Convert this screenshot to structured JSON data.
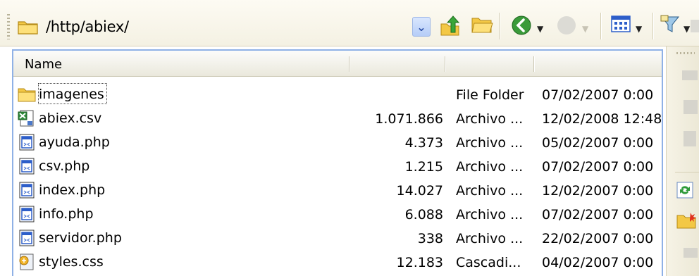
{
  "toolbar": {
    "path": "/http/abiex/",
    "icons": [
      "folder-icon",
      "dropdown-arrow-icon",
      "up-folder-icon",
      "open-folder-icon",
      "back-icon",
      "forward-icon",
      "view-icon",
      "filter-icon",
      "disconnect-icon"
    ]
  },
  "list": {
    "columns": [
      "Name",
      "",
      "",
      ""
    ],
    "rows": [
      {
        "icon": "folder-icon",
        "name": "imagenes",
        "size": "",
        "type": "File Folder",
        "date": "07/02/2007 0:00"
      },
      {
        "icon": "csv-file-icon",
        "name": "abiex.csv",
        "size": "1.071.866",
        "type": "Archivo ...",
        "date": "12/02/2008 12:48"
      },
      {
        "icon": "php-file-icon",
        "name": "ayuda.php",
        "size": "4.373",
        "type": "Archivo ...",
        "date": "05/02/2007 0:00"
      },
      {
        "icon": "php-file-icon",
        "name": "csv.php",
        "size": "1.215",
        "type": "Archivo ...",
        "date": "07/02/2007 0:00"
      },
      {
        "icon": "php-file-icon",
        "name": "index.php",
        "size": "14.027",
        "type": "Archivo ...",
        "date": "12/02/2007 0:00"
      },
      {
        "icon": "php-file-icon",
        "name": "info.php",
        "size": "6.088",
        "type": "Archivo ...",
        "date": "07/02/2007 0:00"
      },
      {
        "icon": "php-file-icon",
        "name": "servidor.php",
        "size": "338",
        "type": "Archivo ...",
        "date": "22/02/2007 0:00"
      },
      {
        "icon": "css-file-icon",
        "name": "styles.css",
        "size": "12.183",
        "type": "Cascadi...",
        "date": "04/02/2007 0:00"
      }
    ]
  },
  "colors": {
    "panel_border": "#8fb1e6",
    "toolbar_bg": "#f4f1e3",
    "back_button": "#3a9a3a"
  }
}
